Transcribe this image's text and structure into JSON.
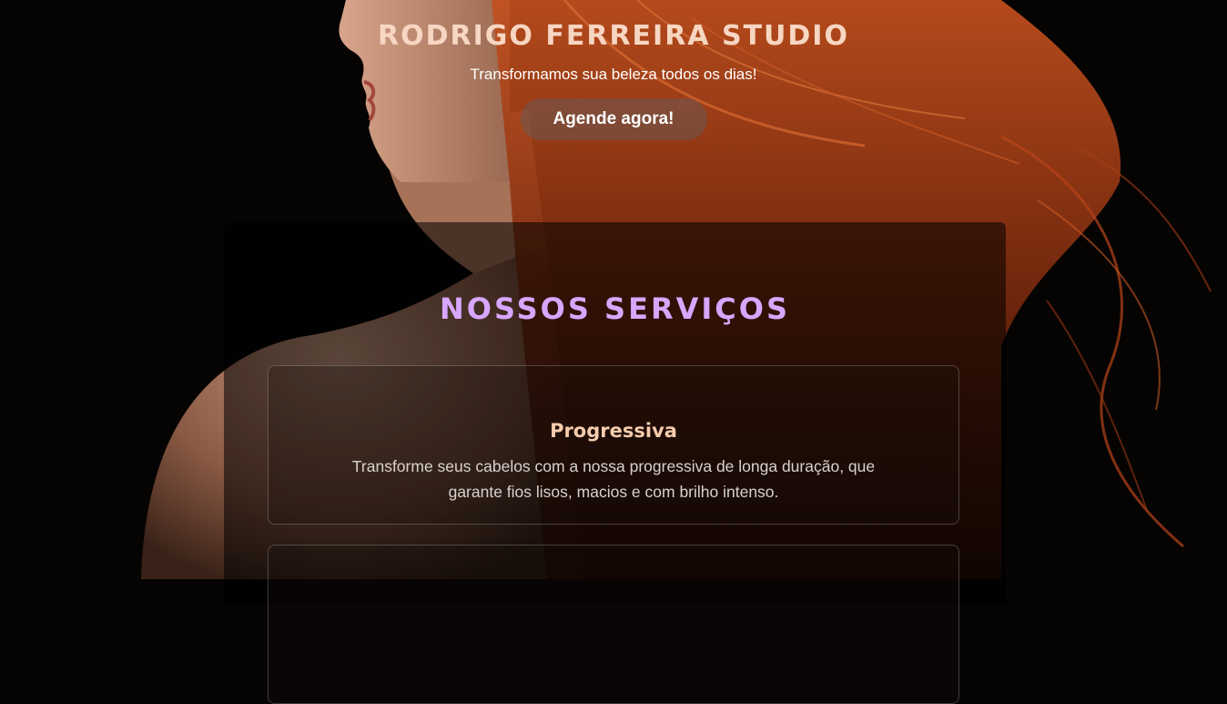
{
  "header": {
    "title": "RODRIGO FERREIRA STUDIO",
    "tagline": "Transformamos sua beleza todos os dias!",
    "cta_label": "Agende agora!"
  },
  "services": {
    "heading": "NOSSOS SERVIÇOS",
    "items": [
      {
        "title": "Progressiva",
        "description": "Transforme seus cabelos com a nossa progressiva de longa duração, que garante fios lisos, macios e com brilho intenso."
      }
    ]
  },
  "colors": {
    "title": "#f7d6c2",
    "services_heading": "#d8a6ff",
    "card_title": "#f6ccae",
    "hair": "#b8451a",
    "background": "#050303"
  }
}
